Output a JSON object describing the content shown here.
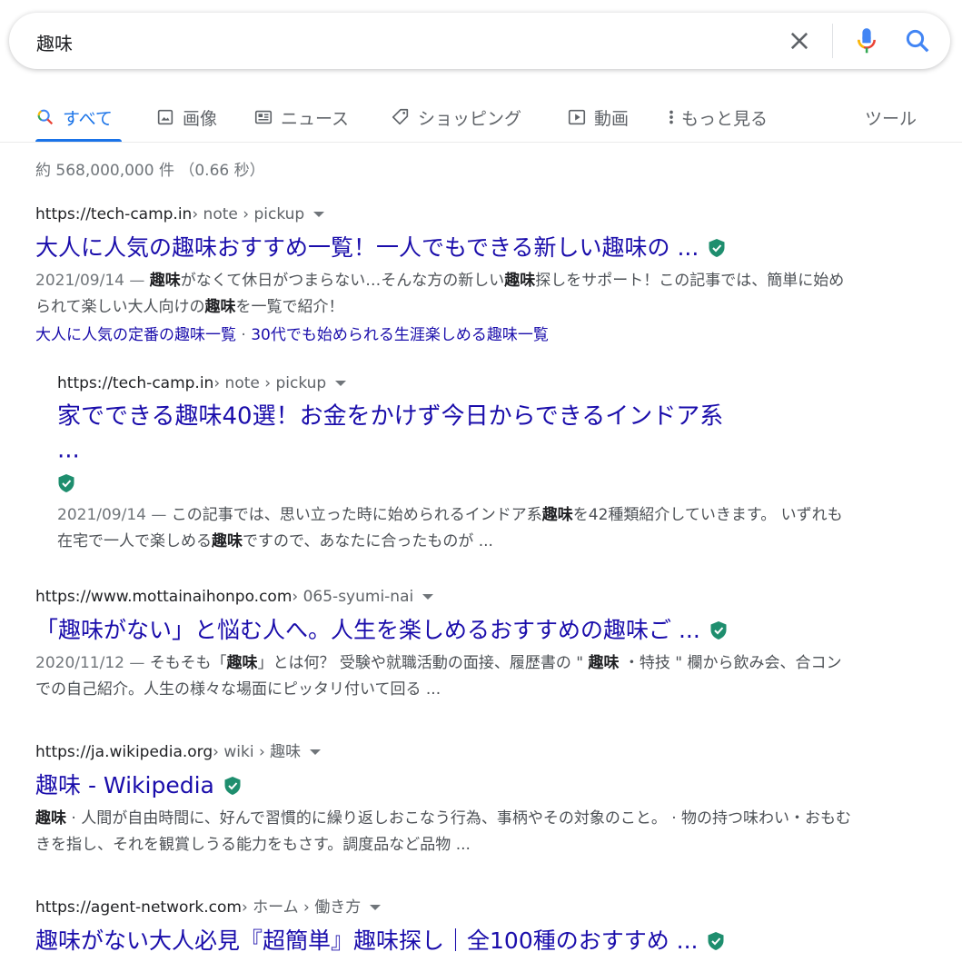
{
  "search": {
    "query": "趣味"
  },
  "icons": {
    "clear": "close-icon",
    "mic": "microphone-icon",
    "search": "search-icon"
  },
  "colors": {
    "link": "#1a0dab",
    "accent": "#1a73e8",
    "verified": "#1e8e6e"
  },
  "tabs": [
    {
      "label": "すべて",
      "icon": "search-icon",
      "active": true
    },
    {
      "label": "画像",
      "icon": "image-icon"
    },
    {
      "label": "ニュース",
      "icon": "news-icon"
    },
    {
      "label": "ショッピング",
      "icon": "tag-icon"
    },
    {
      "label": "動画",
      "icon": "video-icon"
    },
    {
      "label": "もっと見る",
      "icon": "more-vert-icon"
    }
  ],
  "tools_label": "ツール",
  "stats": "約 568,000,000 件 （0.66 秒）",
  "results": [
    {
      "site": "https://tech-camp.in",
      "path": " › note › pickup",
      "title": "大人に人気の趣味おすすめ一覧！一人でもできる新しい趣味の ...",
      "date": "2021/09/14 — ",
      "snippet_parts": [
        "",
        "趣味",
        "がなくて休日がつまらない…そんな方の新しい",
        "趣味",
        "探しをサポート！この記事では、簡単に始められて楽しい大人向けの",
        "趣味",
        "を一覧で紹介！"
      ],
      "sitelinks": [
        "大人に人気の定番の趣味一覧",
        "30代でも始められる生涯楽しめる趣味一覧"
      ]
    },
    {
      "site": "https://tech-camp.in",
      "path": " › note › pickup",
      "title_line1": "家でできる趣味40選！お金をかけず今日からできるインドア系",
      "title_line2": "...",
      "date": "2021/09/14 — ",
      "snippet_parts": [
        "この記事では、思い立った時に始められるインドア系",
        "趣味",
        "を42種類紹介していきます。 いずれも在宅で一人で楽しめる",
        "趣味",
        "ですので、あなたに合ったものが ..."
      ]
    },
    {
      "site": "https://www.mottainaihonpo.com",
      "path": " › 065-syumi-nai",
      "title": "「趣味がない」と悩む人へ。人生を楽しめるおすすめの趣味ご ...",
      "date": "2020/11/12 — ",
      "snippet_parts": [
        "そもそも「",
        "趣味",
        "」とは何？ 受験や就職活動の面接、履歴書の \" ",
        "趣味",
        " ・特技 \" 欄から飲み会、合コンでの自己紹介。人生の様々な場面にピッタリ付いて回る ..."
      ]
    },
    {
      "site": "https://ja.wikipedia.org",
      "path": " › wiki › 趣味",
      "title": "趣味 - Wikipedia",
      "snippet_parts": [
        "",
        "趣味",
        " · 人間が自由時間に、好んで習慣的に繰り返しおこなう行為、事柄やその対象のこと。 · 物の持つ味わい・おもむきを指し、それを観賞しうる能力をもさす。調度品など品物 ..."
      ]
    },
    {
      "site": "https://agent-network.com",
      "path": " › ホーム › 働き方",
      "title": "趣味がない大人必見『超簡単』趣味探し｜全100種のおすすめ ..."
    }
  ]
}
